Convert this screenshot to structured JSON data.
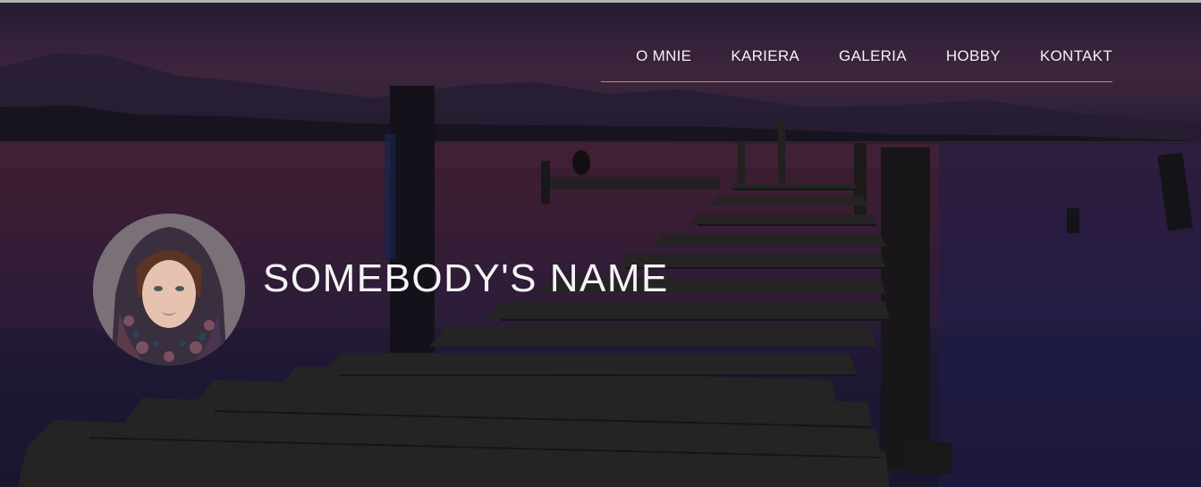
{
  "nav": {
    "items": [
      {
        "label": "O MNIE"
      },
      {
        "label": "KARIERA"
      },
      {
        "label": "GALERIA"
      },
      {
        "label": "HOBBY"
      },
      {
        "label": "KONTAKT"
      }
    ],
    "underline_color": "#c9944a"
  },
  "hero": {
    "name": "SOMEBODY'S NAME",
    "background_image": "pier-at-dusk",
    "avatar_image": "woman-with-headscarf"
  }
}
